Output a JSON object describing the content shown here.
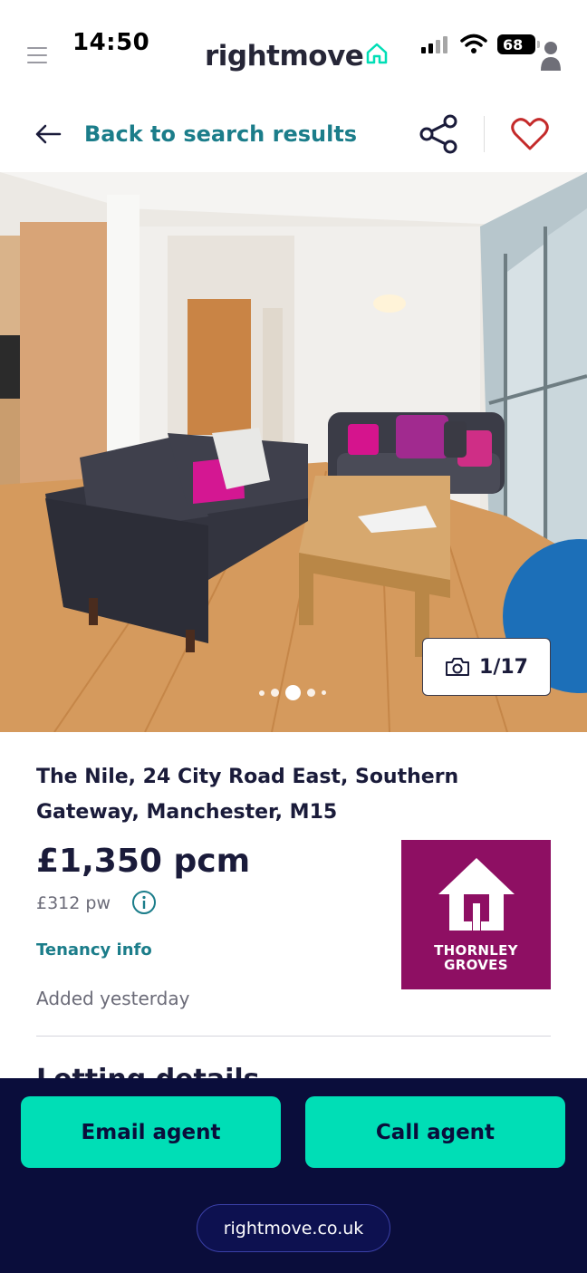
{
  "status_bar": {
    "time": "14:50",
    "battery": "68"
  },
  "header": {
    "logo_text": "rightmove"
  },
  "nav": {
    "back_label": "Back to search results"
  },
  "photo": {
    "counter": "1/17",
    "current_index": 1,
    "total": 17
  },
  "listing": {
    "address": "The Nile, 24 City Road East, Southern Gateway, Manchester, M15",
    "price_pcm": "£1,350 pcm",
    "price_pw": "£312 pw",
    "tenancy_link": "Tenancy info",
    "added": "Added yesterday",
    "next_section": "Letting details"
  },
  "agent": {
    "name_line1": "THORNLEY",
    "name_line2": "GROVES",
    "brand_color": "#8e0f63"
  },
  "actions": {
    "email_label": "Email agent",
    "call_label": "Call agent"
  },
  "footer": {
    "url": "rightmove.co.uk"
  },
  "colors": {
    "accent_teal": "#1b7d8a",
    "cta_green": "#00deb6",
    "navy": "#0a0d3b",
    "heart_red": "#c42a2a"
  },
  "icons": [
    "menu-icon",
    "back-arrow-icon",
    "share-icon",
    "heart-icon",
    "camera-icon",
    "info-icon",
    "house-logo-icon",
    "avatar-icon",
    "wifi-icon",
    "signal-icon"
  ]
}
